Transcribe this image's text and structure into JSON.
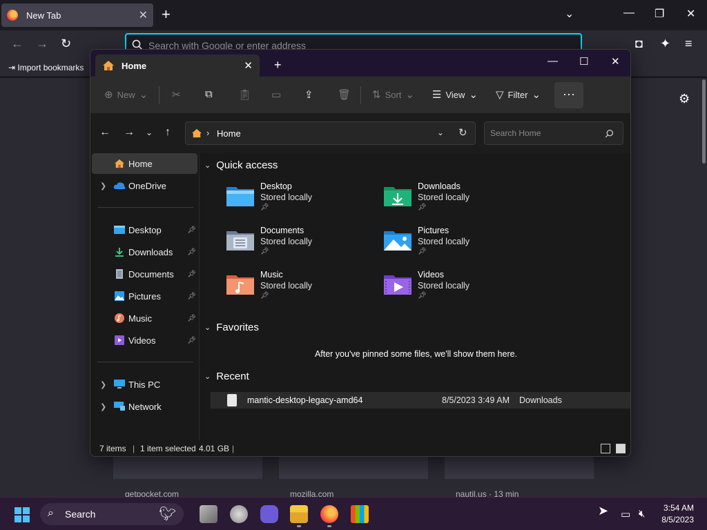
{
  "firefox": {
    "tab_title": "New Tab",
    "url_placeholder": "Search with Google or enter address",
    "import_bookmarks": "Import bookmarks",
    "tiles": [
      "getpocket.com",
      "mozilla.com",
      "nautil.us · 13 min"
    ]
  },
  "explorer": {
    "tab_title": "Home",
    "toolbar": {
      "new": "New",
      "sort": "Sort",
      "view": "View",
      "filter": "Filter"
    },
    "breadcrumb": "Home",
    "search_placeholder": "Search Home",
    "sidebar": {
      "top": [
        {
          "label": "Home",
          "selected": true,
          "icon": "home-icon"
        },
        {
          "label": "OneDrive",
          "icon": "cloud-icon"
        }
      ],
      "pinned": [
        {
          "label": "Desktop",
          "icon": "desktop-icon"
        },
        {
          "label": "Downloads",
          "icon": "download-icon"
        },
        {
          "label": "Documents",
          "icon": "document-icon"
        },
        {
          "label": "Pictures",
          "icon": "picture-icon"
        },
        {
          "label": "Music",
          "icon": "music-icon"
        },
        {
          "label": "Videos",
          "icon": "video-icon"
        }
      ],
      "bottom": [
        {
          "label": "This PC",
          "icon": "pc-icon"
        },
        {
          "label": "Network",
          "icon": "network-icon"
        }
      ]
    },
    "quick_access": {
      "title": "Quick access",
      "items": [
        {
          "name": "Desktop",
          "sub": "Stored locally"
        },
        {
          "name": "Downloads",
          "sub": "Stored locally"
        },
        {
          "name": "Documents",
          "sub": "Stored locally"
        },
        {
          "name": "Pictures",
          "sub": "Stored locally"
        },
        {
          "name": "Music",
          "sub": "Stored locally"
        },
        {
          "name": "Videos",
          "sub": "Stored locally"
        }
      ]
    },
    "favorites": {
      "title": "Favorites",
      "message": "After you've pinned some files, we'll show them here."
    },
    "recent": {
      "title": "Recent",
      "rows": [
        {
          "name": "mantic-desktop-legacy-amd64",
          "date": "8/5/2023 3:49 AM",
          "location": "Downloads"
        }
      ]
    },
    "status": {
      "items": "7 items",
      "selected": "1 item selected",
      "size": "4.01 GB"
    }
  },
  "taskbar": {
    "search": "Search",
    "time": "3:54 AM",
    "date": "8/5/2023"
  },
  "colors": {
    "accent": "#00ddff",
    "folder_blue": "#3aa0ef",
    "taskbar": "#2a1a33"
  }
}
